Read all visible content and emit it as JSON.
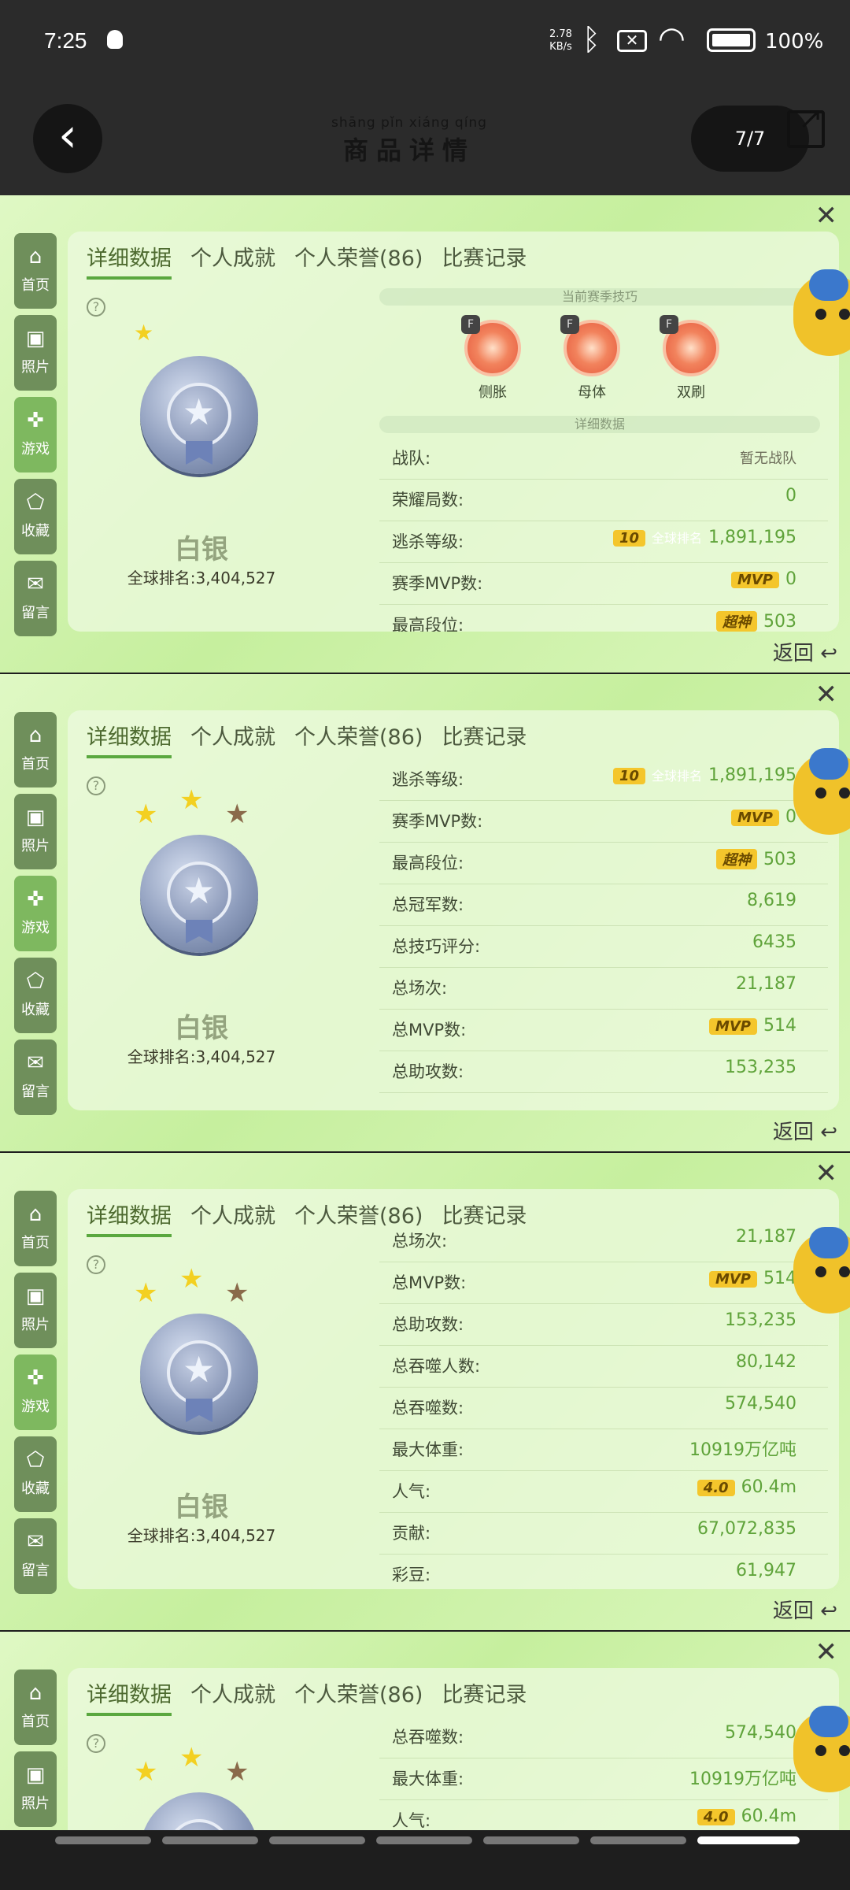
{
  "status_bar": {
    "time": "7:25",
    "net_speed": "2.78",
    "net_unit": "KB/s",
    "battery": "100%"
  },
  "header": {
    "back_icon": "chevron-left-icon",
    "title_pinyin": "shāng pǐn xiáng qíng",
    "title": "商品详情",
    "page": "7/7"
  },
  "sidebar": [
    "首页",
    "照片",
    "游戏",
    "收藏",
    "留言"
  ],
  "tabs": [
    "详细数据",
    "个人成就",
    "个人荣誉(86)",
    "比赛记录"
  ],
  "profile": {
    "rank_name": "白银",
    "global_rank": "全球排名:3,404,527"
  },
  "common": {
    "return_label": "返回",
    "close": "✕",
    "help": "?"
  },
  "panel1": {
    "skills_heading": "当前赛季技巧",
    "detail_heading": "详细数据",
    "skills": [
      {
        "name": "侧胀"
      },
      {
        "name": "母体"
      },
      {
        "name": "双刷"
      }
    ],
    "rows": [
      {
        "label": "战队:",
        "value": "暂无战队"
      },
      {
        "label": "荣耀局数:",
        "value": "0"
      },
      {
        "label": "逃杀等级:",
        "value": "1,891,195",
        "badge": "10",
        "extra": "全球排名"
      },
      {
        "label": "赛季MVP数:",
        "value": "0",
        "badge": "MVP"
      },
      {
        "label": "最高段位:",
        "value": "503",
        "badge": "超神"
      }
    ]
  },
  "panel2": {
    "rows": [
      {
        "label": "逃杀等级:",
        "value": "1,891,195",
        "badge": "10",
        "extra": "全球排名"
      },
      {
        "label": "赛季MVP数:",
        "value": "0",
        "badge": "MVP"
      },
      {
        "label": "最高段位:",
        "value": "503",
        "badge": "超神"
      },
      {
        "label": "总冠军数:",
        "value": "8,619"
      },
      {
        "label": "总技巧评分:",
        "value": "6435"
      },
      {
        "label": "总场次:",
        "value": "21,187"
      },
      {
        "label": "总MVP数:",
        "value": "514",
        "badge": "MVP"
      },
      {
        "label": "总助攻数:",
        "value": "153,235"
      }
    ]
  },
  "panel3": {
    "rows": [
      {
        "label": "总场次:",
        "value": "21,187"
      },
      {
        "label": "总MVP数:",
        "value": "514",
        "badge": "MVP"
      },
      {
        "label": "总助攻数:",
        "value": "153,235"
      },
      {
        "label": "总吞噬人数:",
        "value": "80,142"
      },
      {
        "label": "总吞噬数:",
        "value": "574,540"
      },
      {
        "label": "最大体重:",
        "value": "10919万亿吨"
      },
      {
        "label": "人气:",
        "value": "60.4m",
        "badge": "4.0"
      },
      {
        "label": "贡献:",
        "value": "67,072,835"
      },
      {
        "label": "彩豆:",
        "value": "61,947"
      }
    ]
  },
  "panel4": {
    "rows": [
      {
        "label": "总吞噬数:",
        "value": "574,540"
      },
      {
        "label": "最大体重:",
        "value": "10919万亿吨"
      },
      {
        "label": "人气:",
        "value": "60.4m",
        "badge": "4.0"
      }
    ]
  }
}
